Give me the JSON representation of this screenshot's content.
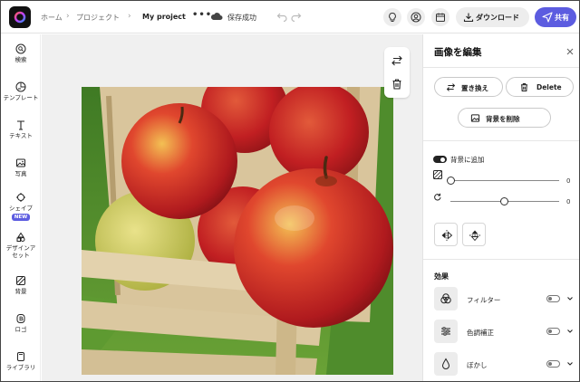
{
  "topbar": {
    "breadcrumb": [
      "ホーム",
      "プロジェクト",
      "My project"
    ],
    "more_label": "•••",
    "save_status": "保存成功",
    "download_label": "ダウンロード",
    "share_label": "共有"
  },
  "sidebar": {
    "items": [
      {
        "label": "検索",
        "icon": "search-icon"
      },
      {
        "label": "テンプレート",
        "icon": "template-icon"
      },
      {
        "label": "テキスト",
        "icon": "text-icon"
      },
      {
        "label": "写真",
        "icon": "photo-icon"
      },
      {
        "label": "シェイプ",
        "icon": "shape-icon",
        "badge": "NEW"
      },
      {
        "label": "デザインアセット",
        "icon": "design-assets-icon"
      },
      {
        "label": "背景",
        "icon": "background-icon"
      },
      {
        "label": "ロゴ",
        "icon": "logo-icon"
      },
      {
        "label": "ライブラリ",
        "icon": "library-icon"
      }
    ]
  },
  "panel": {
    "title": "画像を編集",
    "replace_label": "置き換え",
    "delete_label": "Delete",
    "remove_bg_label": "背景を削除",
    "add_to_bg_label": "背景に追加",
    "add_to_bg_on": true,
    "opacity_value": "0",
    "rotation_value": "0",
    "rotation_level": 0.5,
    "effects_title": "効果",
    "effects": [
      {
        "label": "フィルター",
        "icon": "filter-icon",
        "on": false
      },
      {
        "label": "色調補正",
        "icon": "adjust-icon",
        "on": false
      },
      {
        "label": "ぼかし",
        "icon": "blur-icon",
        "on": false
      }
    ]
  },
  "colors": {
    "accent": "#5c5ce0",
    "canvas_bg": "#f0f0f0"
  }
}
